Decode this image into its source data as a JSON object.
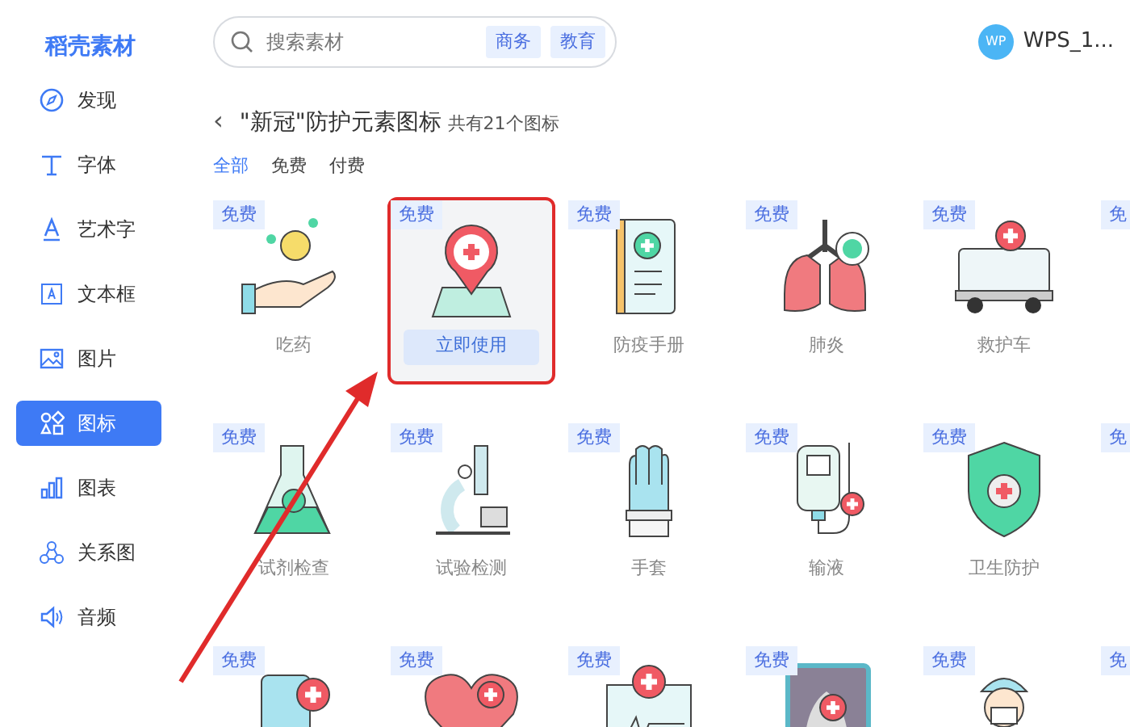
{
  "logo": "稻壳素材",
  "search": {
    "placeholder": "搜索素材",
    "tags": [
      "商务",
      "教育"
    ]
  },
  "user": {
    "avatar": "WP",
    "name": "WPS_1..."
  },
  "sidebar": {
    "items": [
      {
        "label": "发现",
        "selected": false
      },
      {
        "label": "字体",
        "selected": false
      },
      {
        "label": "艺术字",
        "selected": false
      },
      {
        "label": "文本框",
        "selected": false
      },
      {
        "label": "图片",
        "selected": false
      },
      {
        "label": "图标",
        "selected": true
      },
      {
        "label": "图表",
        "selected": false
      },
      {
        "label": "关系图",
        "selected": false
      },
      {
        "label": "音频",
        "selected": false
      }
    ]
  },
  "back": "‹",
  "title": "\"新冠\"防护元素图标",
  "count": "共有21个图标",
  "filters": [
    {
      "label": "全部",
      "selected": true
    },
    {
      "label": "免费",
      "selected": false
    },
    {
      "label": "付费",
      "selected": false
    }
  ],
  "items": [
    {
      "tag": "免费",
      "name": "吃药"
    },
    {
      "tag": "免费",
      "name": "立即使用",
      "hovered": true
    },
    {
      "tag": "免费",
      "name": "防疫手册"
    },
    {
      "tag": "免费",
      "name": "肺炎"
    },
    {
      "tag": "免费",
      "name": "救护车"
    },
    {
      "tag": "免"
    },
    {
      "tag": "免费",
      "name": "试剂检查"
    },
    {
      "tag": "免费",
      "name": "试验检测"
    },
    {
      "tag": "免费",
      "name": "手套"
    },
    {
      "tag": "免费",
      "name": "输液"
    },
    {
      "tag": "免费",
      "name": "卫生防护"
    },
    {
      "tag": "免"
    },
    {
      "tag": "免费"
    },
    {
      "tag": "免费"
    },
    {
      "tag": "免费"
    },
    {
      "tag": "免费"
    },
    {
      "tag": "免费"
    },
    {
      "tag": "免"
    }
  ]
}
